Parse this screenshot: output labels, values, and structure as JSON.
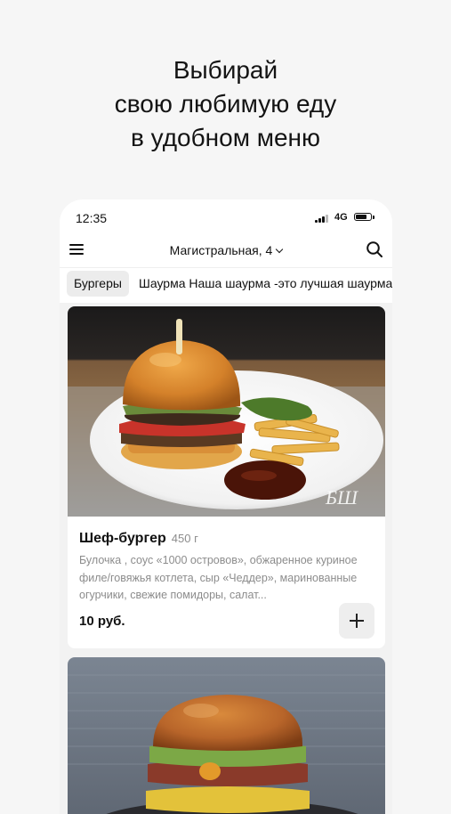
{
  "headline": {
    "line1": "Выбирай",
    "line2": "свою любимую еду",
    "line3": "в удобном меню"
  },
  "status_bar": {
    "time": "12:35",
    "network": "4G",
    "battery_level": 0.85
  },
  "nav": {
    "address": "Магистральная, 4",
    "menu_icon": "hamburger-menu-icon",
    "search_icon": "search-icon"
  },
  "categories": {
    "active": "Бургеры",
    "next": "Шаурма Наша шаурма -это лучшая шаурма"
  },
  "products": [
    {
      "title": "Шеф-бургер",
      "weight": "450 г",
      "description": "Булочка , соус «1000 островов», обжаренное куриное филе/говяжья котлета, сыр «Чеддер», маринованные огурчики, свежие помидоры, салат...",
      "price": "10 руб.",
      "watermark": "БШ"
    }
  ],
  "colors": {
    "page_background": "#f6f6f6",
    "feed_background": "#f2f2f2",
    "accent_text": "#111111",
    "muted_text": "#8c8c8c"
  }
}
